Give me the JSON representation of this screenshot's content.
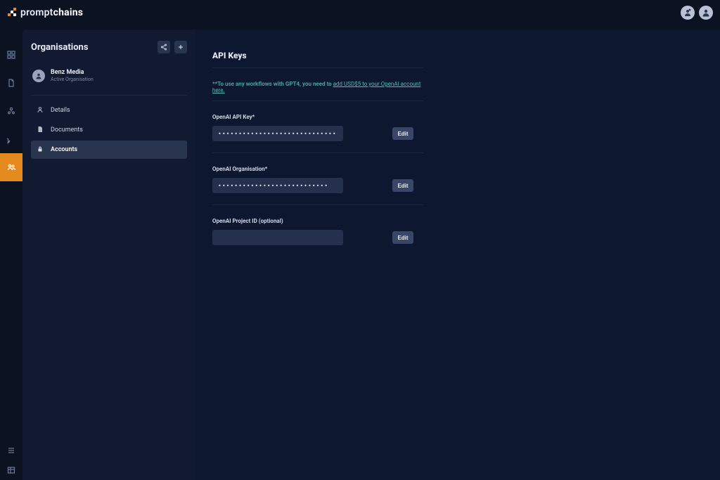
{
  "brand": {
    "name_a": "prompt",
    "name_b": "chains"
  },
  "rail": {
    "items": [
      {
        "name": "dashboard"
      },
      {
        "name": "documents"
      },
      {
        "name": "team"
      },
      {
        "name": "chat"
      },
      {
        "name": "organisations",
        "active": true
      }
    ],
    "bottom": [
      {
        "name": "list"
      },
      {
        "name": "grid"
      }
    ]
  },
  "sidepanel": {
    "title": "Organisations",
    "org": {
      "name": "Benz Media",
      "subtitle": "Active Organisation"
    },
    "nav": [
      {
        "key": "details",
        "label": "Details"
      },
      {
        "key": "documents",
        "label": "Documents"
      },
      {
        "key": "accounts",
        "label": "Accounts",
        "active": true
      }
    ]
  },
  "main": {
    "title": "API Keys",
    "notice_prefix": "**To use any workflows with GPT4, you need to ",
    "notice_link": "add USD$5 to your OpenAI account here.",
    "fields": [
      {
        "key": "openai_key",
        "label": "OpenAI API Key*",
        "value": "••••••••••••••••••••••••••••••••••••••••••••••••",
        "edit": "Edit"
      },
      {
        "key": "openai_org",
        "label": "OpenAI Organisation*",
        "value": "•••••••••••••••••••••••••••",
        "edit": "Edit"
      },
      {
        "key": "openai_project",
        "label": "OpenAI Project ID (optional)",
        "value": "",
        "edit": "Edit"
      }
    ]
  }
}
